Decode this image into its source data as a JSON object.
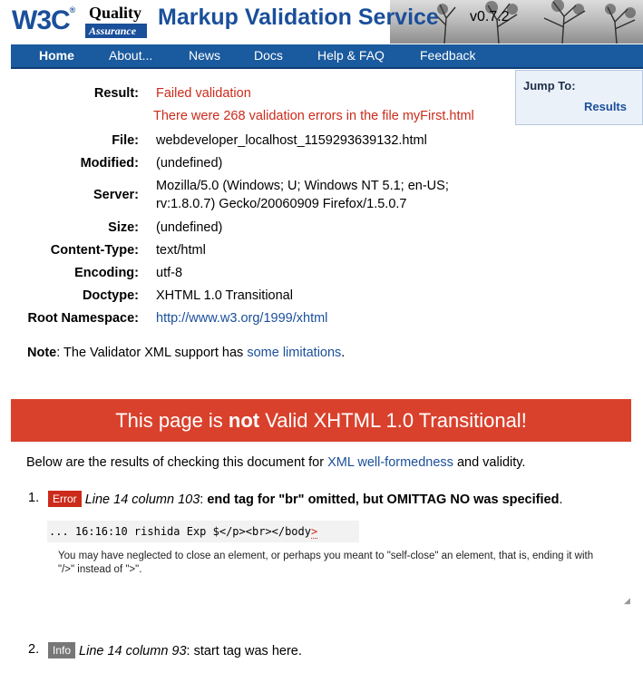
{
  "header": {
    "w3c_logo": "W3C",
    "qa_logo_top": "Quality",
    "qa_logo_bottom": "Assurance",
    "title": "Markup Validation Service",
    "version": "v0.7.2"
  },
  "nav": {
    "items": [
      "Home",
      "About...",
      "News",
      "Docs",
      "Help & FAQ",
      "Feedback"
    ]
  },
  "jump": {
    "label": "Jump To:",
    "link": "Results"
  },
  "meta": {
    "result_key": "Result:",
    "result_value": "Failed validation",
    "result_detail": "There were 268 validation errors in the file myFirst.html",
    "file_key": "File:",
    "file_value": "webdeveloper_localhost_1159293639132.html",
    "modified_key": "Modified:",
    "modified_value": "(undefined)",
    "server_key": "Server:",
    "server_value_1": "Mozilla/5.0 (Windows; U; Windows NT 5.1; en-US;",
    "server_value_2": "rv:1.8.0.7) Gecko/20060909 Firefox/1.5.0.7",
    "size_key": "Size:",
    "size_value": "(undefined)",
    "ctype_key": "Content-Type:",
    "ctype_value": "text/html",
    "encoding_key": "Encoding:",
    "encoding_value": "utf-8",
    "doctype_key": "Doctype:",
    "doctype_value": "XHTML 1.0 Transitional",
    "ns_key": "Root Namespace:",
    "ns_value": "http://www.w3.org/1999/xhtml"
  },
  "note": {
    "label": "Note",
    "text": ": The Validator XML support has ",
    "link": "some limitations",
    "end": "."
  },
  "failure": {
    "pre": "This page is ",
    "strong": "not",
    "post": " Valid XHTML 1.0 Transitional!"
  },
  "below": {
    "pre": "Below are the results of checking this document for ",
    "link": "XML well-formedness",
    "post": " and validity."
  },
  "messages": [
    {
      "num": "1.",
      "badge": "Error",
      "location": "Line 14 column 103",
      "text": "end tag for \"br\" omitted, but OMITTAG NO was specified",
      "code": "... 16:16:10 rishida Exp $</p><br></body",
      "code_mark": ">",
      "explain": "You may have neglected to close an element, or perhaps you meant to \"self-close\" an element, that is, ending it with \"/>\" instead of \">\"."
    },
    {
      "num": "2.",
      "badge": "Info",
      "location": "Line 14 column 93",
      "text": ": start tag was here."
    }
  ]
}
